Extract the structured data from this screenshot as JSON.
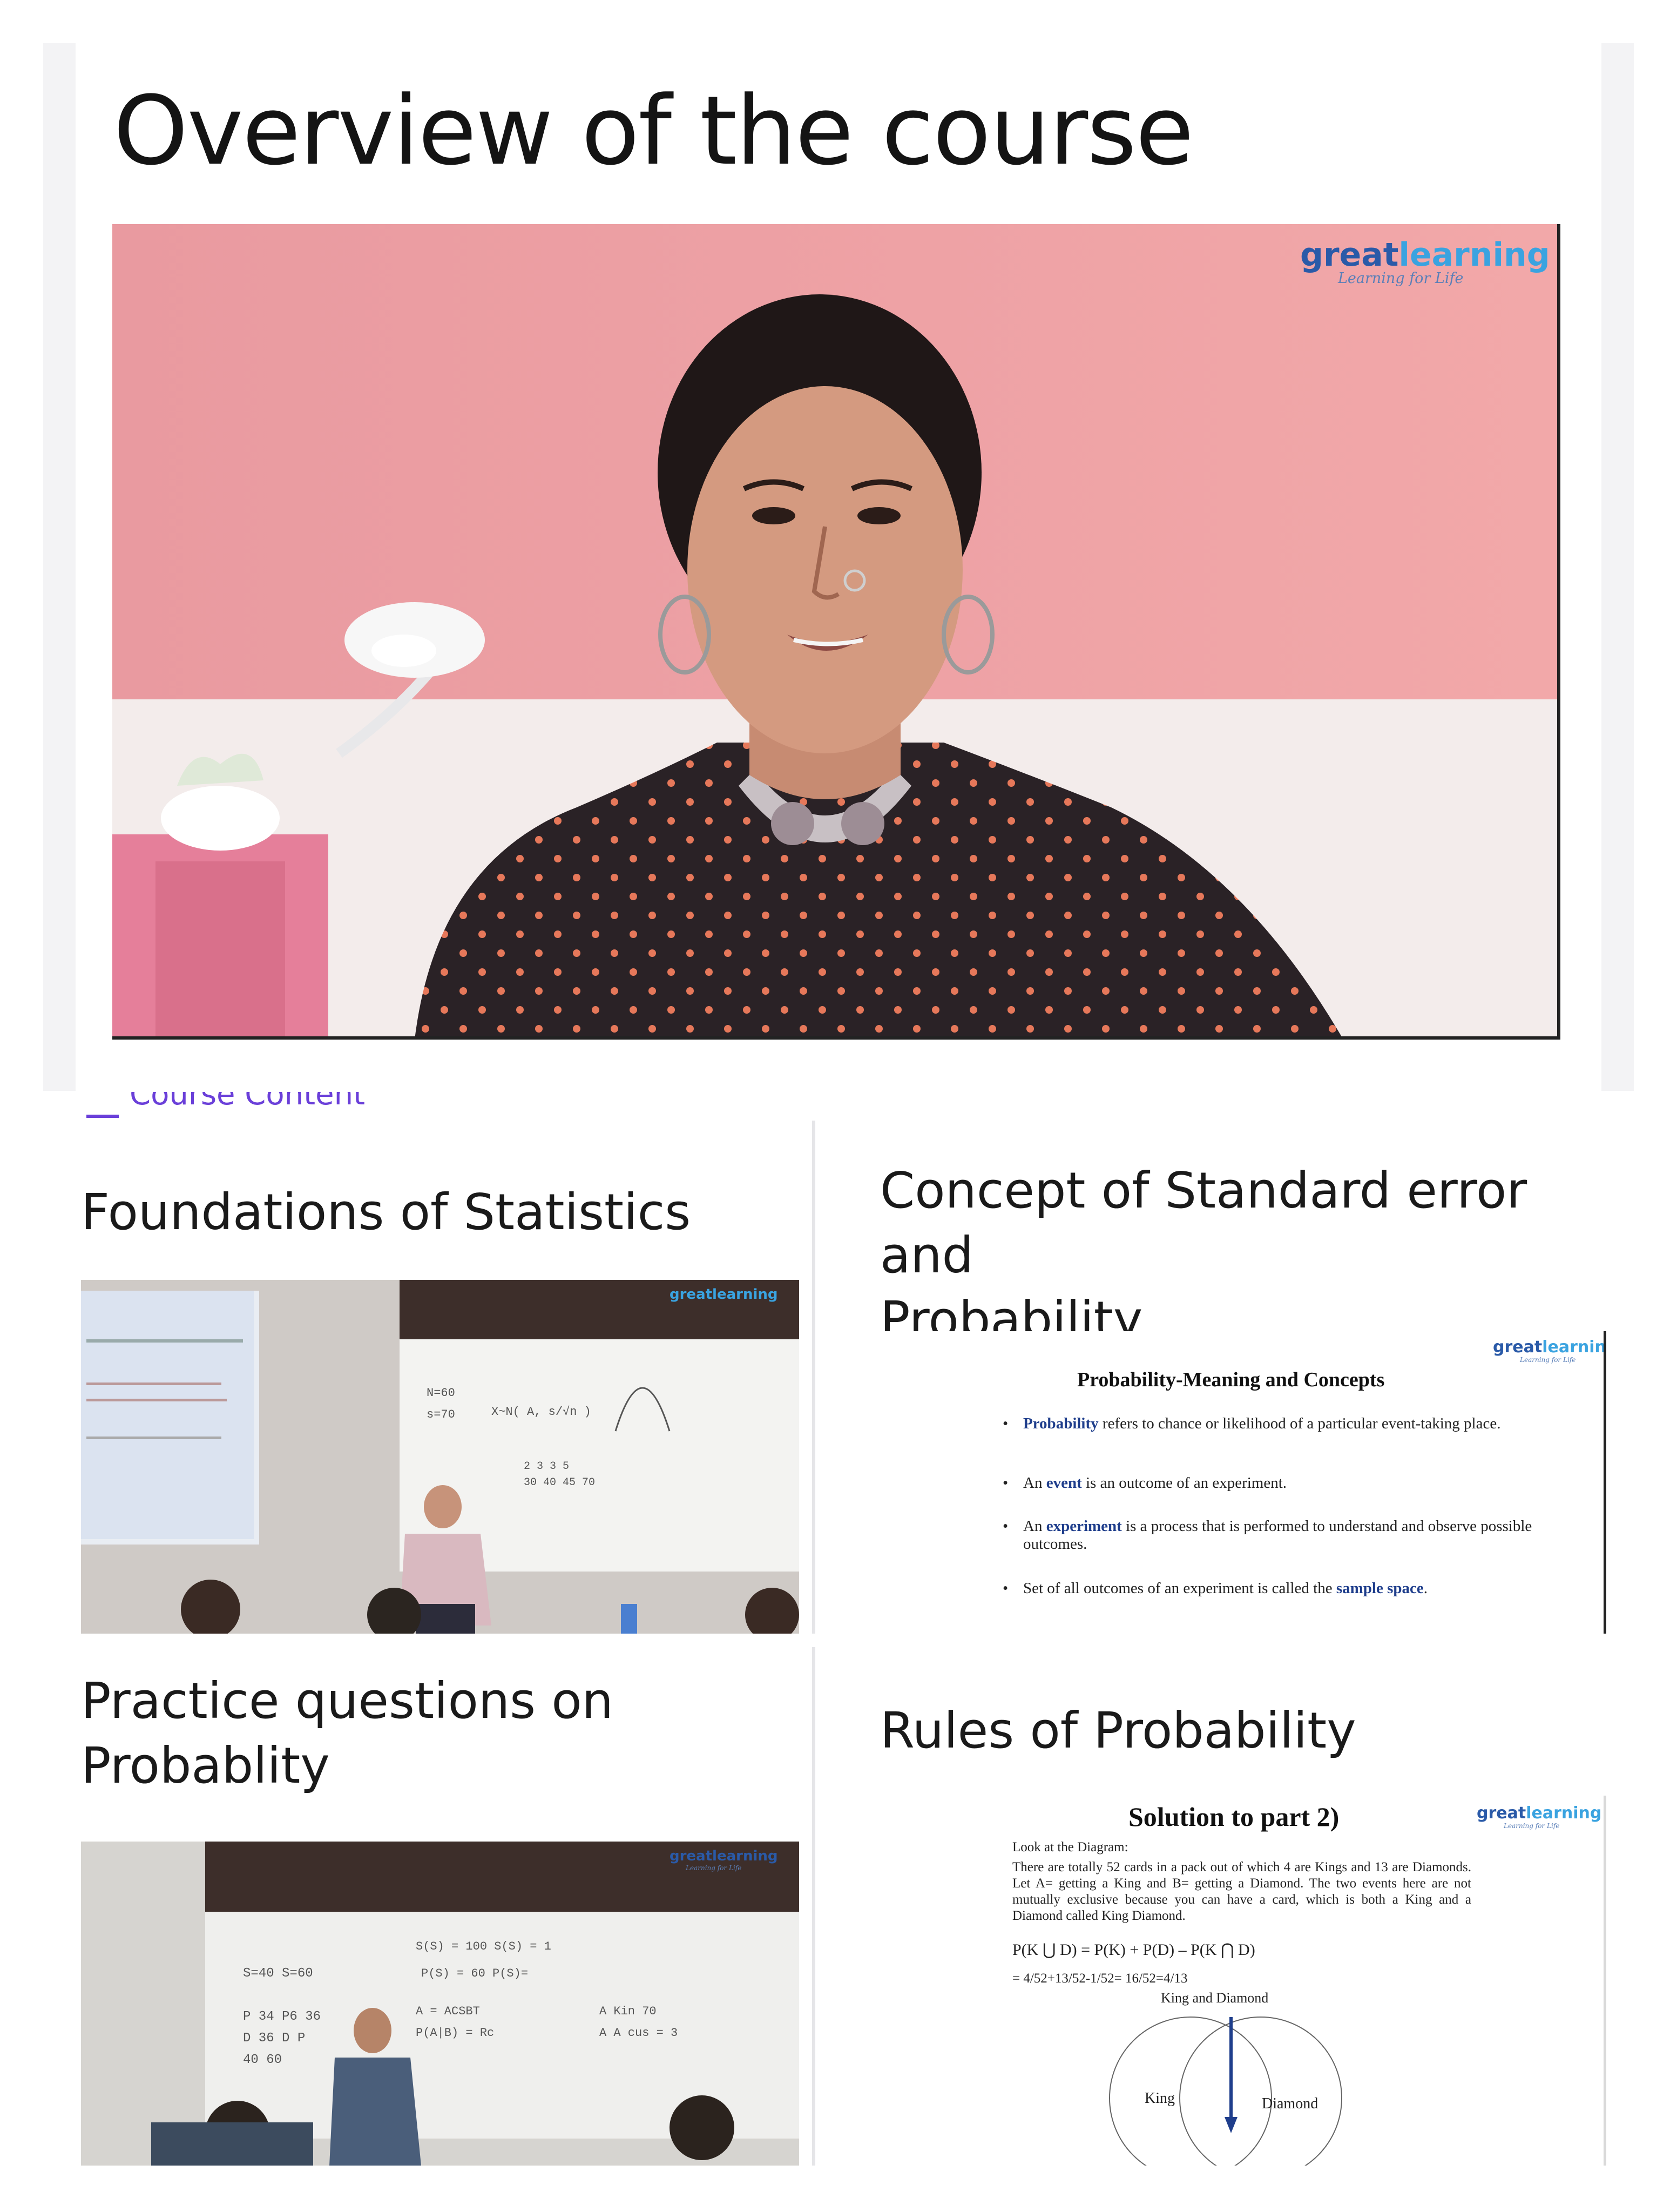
{
  "header": {
    "title": "Overview of the course"
  },
  "hero_video": {
    "brand": {
      "part1": "great",
      "part2": "learning",
      "tagline": "Learning for Life"
    }
  },
  "section": {
    "label": "Course Content"
  },
  "cards": [
    {
      "title": "Foundations of Statistics",
      "thumb_brand": "greatlearning"
    },
    {
      "title_line1": "Concept of Standard error and",
      "title_line2": "Probability",
      "slide": {
        "brand": "greatlearning",
        "brand_tag": "Learning for Life",
        "heading": "Probability-Meaning and Concepts",
        "bullets": [
          {
            "kw": "Probability",
            "text": " refers to chance or likelihood of a particular event-taking place."
          },
          {
            "pre": "An ",
            "kw": "event",
            "text": " is an outcome of an experiment."
          },
          {
            "pre": "An ",
            "kw": "experiment",
            "text": " is a process that is performed to understand and observe possible outcomes."
          },
          {
            "pre": "Set of all outcomes of an experiment is called the ",
            "kw": "sample space",
            "text": "."
          }
        ]
      }
    },
    {
      "title_line1": "Practice questions on",
      "title_line2": "Probablity",
      "thumb_brand": "greatlearning",
      "thumb_tag": "Learning for Life"
    },
    {
      "title": "Rules of Probability",
      "slide": {
        "brand": "greatlearning",
        "brand_tag": "Learning for Life",
        "heading": "Solution to part 2)",
        "intro": "Look at the Diagram:",
        "para": "There are totally 52 cards in a pack out of which 4 are Kings and 13 are Diamonds. Let A= getting a King and B= getting a Diamond. The two events here are not mutually exclusive because you can have a card, which is both a King and a Diamond called King Diamond.",
        "formula": "P(K ⋃ D) = P(K) + P(D) – P(K ⋂ D)",
        "formula2": "= 4/52+13/52-1/52= 16/52=4/13",
        "venn_caption": "King and Diamond",
        "venn_left": "King",
        "venn_right": "Diamond"
      }
    }
  ],
  "colors": {
    "accent_purple": "#6a3fd9",
    "brand_dark_blue": "#2a5aa8",
    "brand_light_blue": "#3aa3e0",
    "keyword_blue": "#1f3e8c"
  }
}
